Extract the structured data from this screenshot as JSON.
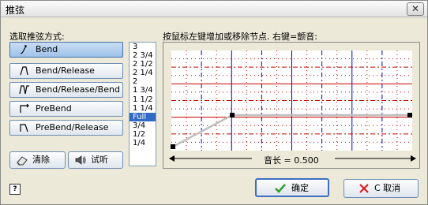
{
  "window": {
    "title": "推弦",
    "close_symbol": "✕"
  },
  "left_panel": {
    "heading": "选取推弦方式:",
    "bend_types": [
      {
        "label": "Bend",
        "icon": "bend-icon",
        "active": true
      },
      {
        "label": "Bend/Release",
        "icon": "bend-release-icon",
        "active": false
      },
      {
        "label": "Bend/Release/Bend",
        "icon": "bend-release-bend-icon",
        "active": false
      },
      {
        "label": "PreBend",
        "icon": "prebend-icon",
        "active": false
      },
      {
        "label": "PreBend/Release",
        "icon": "prebend-release-icon",
        "active": false
      }
    ],
    "amount_list": [
      "3",
      "2 3/4",
      "2 1/2",
      "2 1/4",
      "2",
      "1 3/4",
      "1 1/2",
      "1 1/4",
      "Full",
      "3/4",
      "1/2",
      "1/4"
    ],
    "selected_amount": "Full",
    "clear_button": "清除",
    "listen_button": "试听"
  },
  "graph": {
    "instruction": "按鼠标左键增加或移除节点. 右键=颤音:",
    "duration_text": "音长 = 0.500",
    "colors": {
      "major_line": "#0000c8",
      "minor_line": "#c80000",
      "dot": "#c80000",
      "curve": "#c0c0c0",
      "node": "#000000"
    }
  },
  "buttons": {
    "ok": {
      "label": "确定",
      "icon": "check-icon",
      "color": "#2ca02c"
    },
    "cancel": {
      "label": "C 取消",
      "icon": "x-icon",
      "color": "#d62020"
    }
  }
}
